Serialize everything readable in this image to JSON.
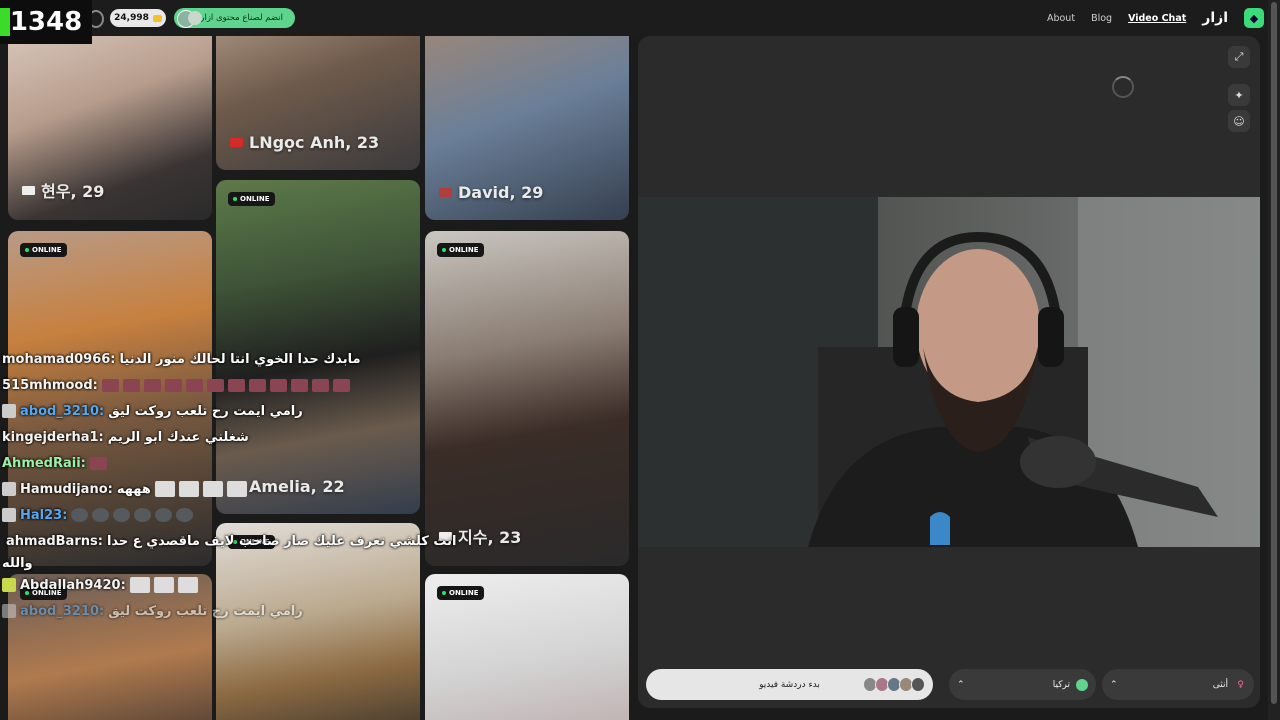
{
  "overlay": {
    "viewer_count": "1348"
  },
  "header": {
    "coin_balance": "24,998",
    "join_creators": "انضم لصناع محتوى ازار",
    "nav": [
      "About",
      "Blog",
      "Video Chat"
    ],
    "brand": "ازار"
  },
  "cards": [
    {
      "name": "현우, 29",
      "online": ""
    },
    {
      "name": "LNgọc Anh, 23",
      "online": ""
    },
    {
      "name": "David, 29",
      "online": ""
    },
    {
      "name": "",
      "online": "ONLINE"
    },
    {
      "name": "Amelia, 22",
      "online": "ONLINE"
    },
    {
      "name": "지수, 23",
      "online": "ONLINE"
    },
    {
      "name": "",
      "online": "ONLINE"
    },
    {
      "name": "",
      "online": "ONLINE"
    },
    {
      "name": "",
      "online": "ONLINE"
    }
  ],
  "chat": [
    {
      "user": "mohamad0966:",
      "msg": "مابدك حدا الخوي انتا لحالك منور الدنيا"
    },
    {
      "user": "515mhmood:",
      "msg": ""
    },
    {
      "user": "abod_3210:",
      "msg": "رامي ايمت رح تلعب روكت ليق"
    },
    {
      "user": "kingejderha1:",
      "msg": "شغلني عندك ابو الريم"
    },
    {
      "user": "AhmedRaii:",
      "msg": ""
    },
    {
      "user": "Hamudijano:",
      "msg": "هههه"
    },
    {
      "user": "Hal23:",
      "msg": ""
    },
    {
      "user": "ahmadBarns:",
      "msg": "انت كلشي تعرف عليك صار صاحب لايف ماقصدي ع حدا"
    },
    {
      "user": "",
      "msg": "والله"
    },
    {
      "user": "Abdallah9420:",
      "msg": ""
    },
    {
      "user": "abod_3210:",
      "msg": "رامي ايمت رح تلعب روكت ليق"
    }
  ],
  "panel": {
    "start_button": "بدء دردشة فيديو",
    "country": "تركيا",
    "gender": "أنثى"
  },
  "colors": {
    "accent_green": "#3bdb7a",
    "online_dot": "#2ee06c",
    "join_pill": "#5fd48f"
  }
}
